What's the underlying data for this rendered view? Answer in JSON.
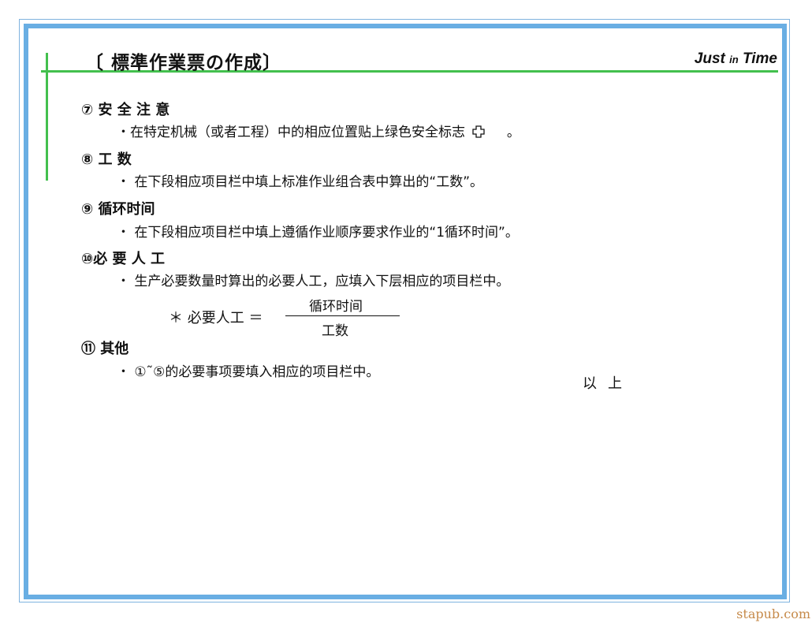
{
  "header": {
    "title": "〔 標準作業票の作成〕",
    "logo_just": "Just",
    "logo_in": "in",
    "logo_time": "Time"
  },
  "items": [
    {
      "heading": "⑦ 安 全 注 意",
      "body": "・在特定机械（或者工程）中的相应位置贴上绿色安全标志",
      "body_suffix": "。"
    },
    {
      "heading": "⑧ 工 数",
      "body": "・  在下段相应项目栏中填上标准作业组合表中算出的“工数”。"
    },
    {
      "heading": "⑨ 循环时间",
      "body": "・  在下段相应项目栏中填上遵循作业顺序要求作业的“1循环时间”。"
    },
    {
      "heading": "⑩必 要 人 工",
      "body": "・  生产必要数量时算出的必要人工，应填入下层相应的项目栏中。"
    },
    {
      "heading": "⑪  其他",
      "body": "・  ①˜⑤的必要事项要填入相应的项目栏中。"
    }
  ],
  "formula": {
    "label": "＊ 必要人工 ＝",
    "numerator": "循环时间",
    "denominator": "工数"
  },
  "closing": "以上",
  "watermark": "stapub.com",
  "colors": {
    "frame": "#69aee3",
    "accent_line": "#43c04e",
    "watermark": "#c68a4a"
  },
  "icons": {
    "safety_mark": "green-cross-icon"
  }
}
